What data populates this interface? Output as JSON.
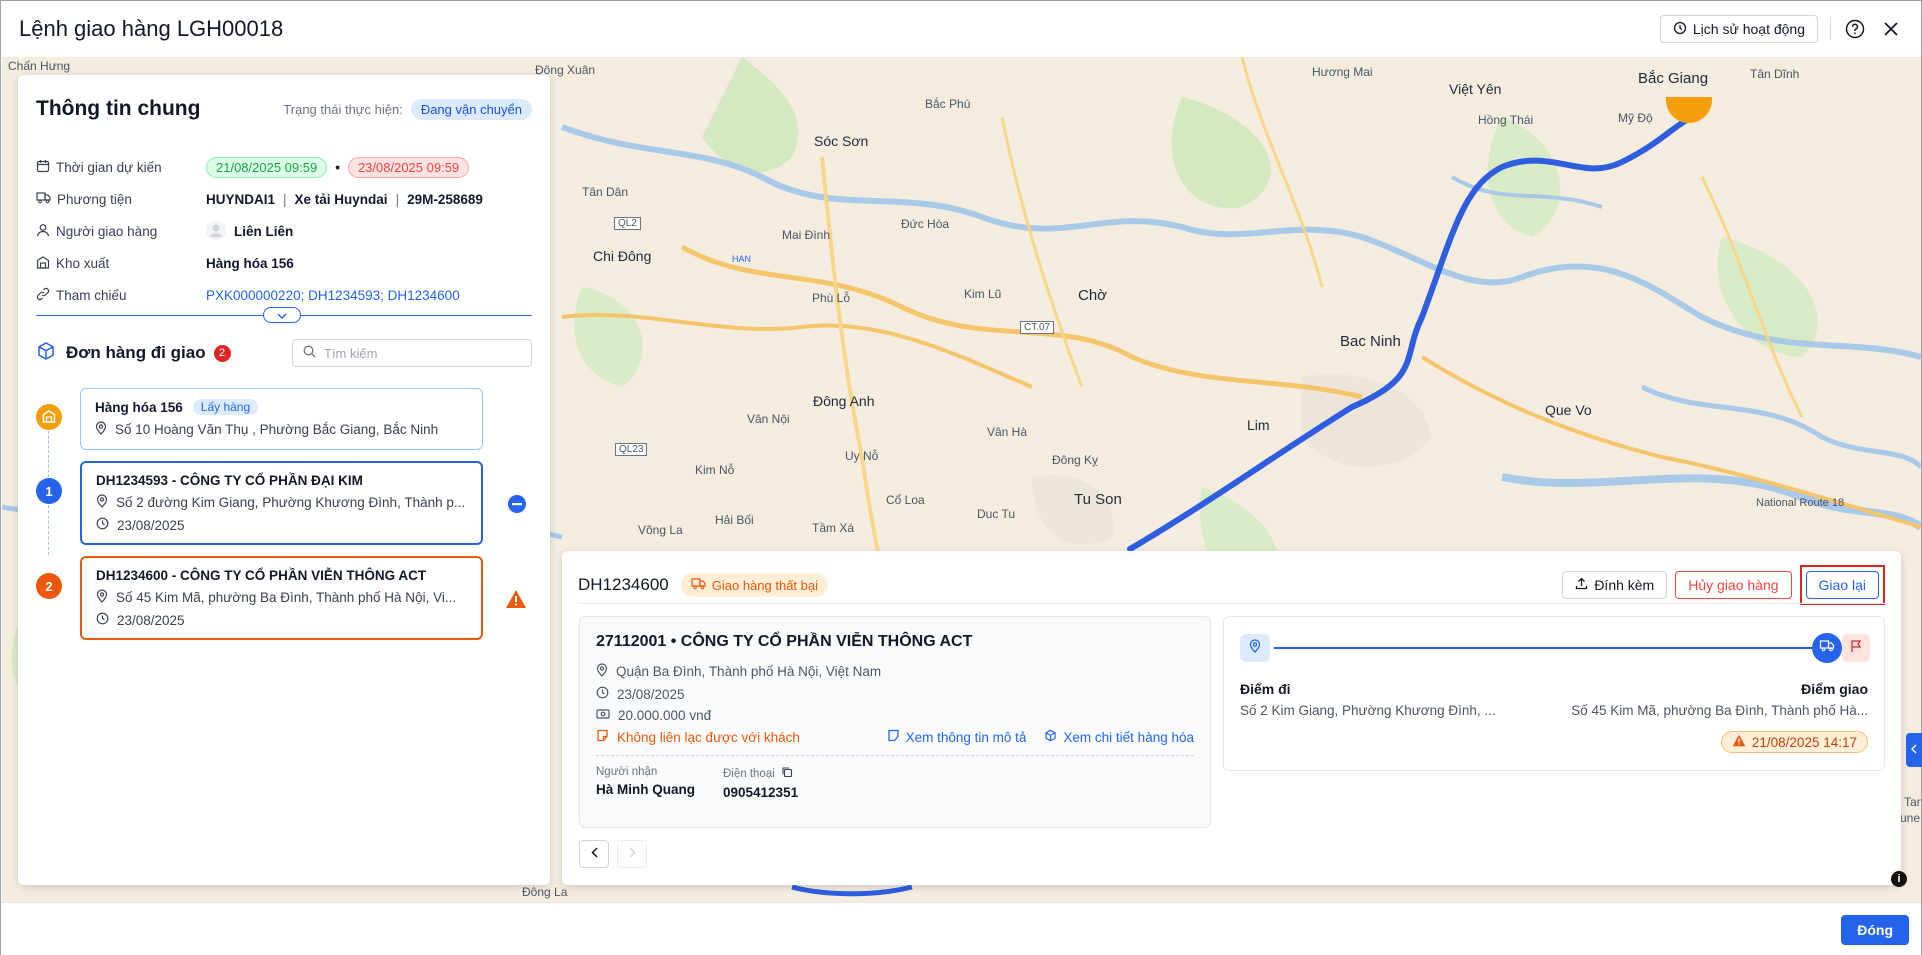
{
  "header": {
    "title": "Lệnh giao hàng LGH00018",
    "history_label": "Lịch sử hoạt động"
  },
  "map": {
    "places": [
      "Chấn Hưng",
      "Đông Xuân",
      "Hương Mai",
      "Việt Yên",
      "Bắc Giang",
      "Tân Dĩnh",
      "Bắc Phú",
      "Sóc Sơn",
      "Hồng Thái",
      "Mỹ Độ",
      "Tân Dân",
      "Chi Đông",
      "Mai Đình",
      "Đức Hòa",
      "Chờ",
      "Kim Lũ",
      "Phù Lỗ",
      "Bac Ninh",
      "Đông Anh",
      "Vân Nội",
      "Lim",
      "Que Vo",
      "Vân Hà",
      "Đông Kỵ",
      "Kim Nỗ",
      "Uy Nỗ",
      "Cổ Loa",
      "Tu Son",
      "Duc Tu",
      "Hải Bối",
      "Tầm Xá",
      "Võng La",
      "National Route 18",
      "Đông La",
      "HAN",
      "Tan",
      "une"
    ],
    "road_labels": [
      "QL2",
      "CT.07",
      "QL23"
    ]
  },
  "general": {
    "title": "Thông tin chung",
    "status_label": "Trạng thái thực hiện:",
    "status_value": "Đang vận chuyển",
    "rows": {
      "time_label": "Thời gian dự kiến",
      "time_start": "21/08/2025 09:59",
      "time_end": "23/08/2025 09:59",
      "vehicle_label": "Phương tiện",
      "vehicle_code": "HUYNDAI1",
      "vehicle_name": "Xe tải Huyndai",
      "vehicle_plate": "29M-258689",
      "driver_label": "Người giao hàng",
      "driver_name": "Liên Liên",
      "warehouse_label": "Kho xuất",
      "warehouse_value": "Hàng hóa 156",
      "ref_label": "Tham chiếu",
      "ref_value": "PXK000000220; DH1234593; DH1234600"
    }
  },
  "orders": {
    "title": "Đơn hàng đi giao",
    "count": "2",
    "search_placeholder": "Tìm kiếm",
    "pickup": {
      "title": "Hàng hóa 156",
      "tag": "Lấy hàng",
      "address": "Số 10 Hoàng Văn Thụ , Phường Bắc Giang, Bắc Ninh"
    },
    "items": [
      {
        "num": "1",
        "title": "DH1234593 - CÔNG TY CỔ PHẦN ĐẠI KIM",
        "address": "Số 2 đường Kim Giang, Phường Khương Đình, Thành p...",
        "date": "23/08/2025"
      },
      {
        "num": "2",
        "title": "DH1234600 - CÔNG TY CỔ PHẦN VIỄN THÔNG ACT",
        "address": "Số 45 Kim Mã, phường Ba Đình, Thành phố Hà Nội, Vi...",
        "date": "23/08/2025"
      }
    ]
  },
  "detail": {
    "code": "DH1234600",
    "status": "Giao hàng thất bại",
    "attach_label": "Đính kèm",
    "cancel_label": "Hủy giao hàng",
    "redeliver_label": "Giao lại",
    "customer": {
      "name": "27112001 • CÔNG TY CỔ PHẦN VIỄN THÔNG ACT",
      "address": "Quận Ba Đình, Thành phố Hà Nội, Việt Nam",
      "date": "23/08/2025",
      "amount": "20.000.000 vnđ",
      "note": "Không liên lạc được với khách",
      "view_desc": "Xem thông tin mô tả",
      "view_goods": "Xem chi tiết hàng hóa",
      "receiver_label": "Người nhận",
      "receiver_value": "Hà Minh Quang",
      "phone_label": "Điện thoại",
      "phone_value": "0905412351"
    },
    "route": {
      "from_label": "Điểm đi",
      "from_addr": "Số 2 Kim Giang, Phường Khương Đình, ...",
      "to_label": "Điểm giao",
      "to_addr": "Số 45 Kim Mã, phường Ba Đình, Thành phố Hà...",
      "eta": "21/08/2025 14:17"
    }
  },
  "footer": {
    "close_label": "Đóng"
  },
  "colors": {
    "primary": "#2563eb",
    "danger": "#dc2626",
    "warning": "#ea580c",
    "success": "#16a34a",
    "route": "#2f5de0"
  }
}
